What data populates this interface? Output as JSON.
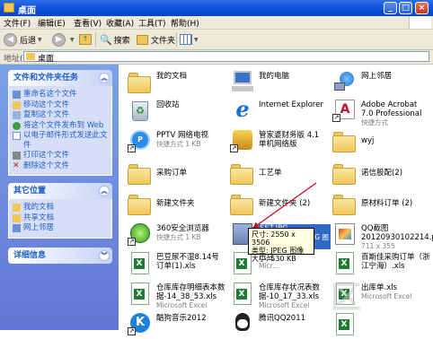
{
  "window": {
    "title": "桌面",
    "buttons": {
      "minimize": "_",
      "maximize": "□",
      "close": "×"
    }
  },
  "menu": [
    "文件(F)",
    "编辑(E)",
    "查看(V)",
    "收藏(A)",
    "工具(T)",
    "帮助(H)"
  ],
  "toolbar": {
    "back": "后退",
    "search": "搜索",
    "folders": "文件夹"
  },
  "address": {
    "label": "地址(D)",
    "value": "桌面"
  },
  "left_panels": [
    {
      "title": "文件和文件夹任务",
      "tasks": [
        "重命名这个文件",
        "移动这个文件",
        "复制这个文件",
        "将这个文件发布到 Web",
        "以电子邮件形式发送此文件",
        "打印这个文件",
        "删除这个文件"
      ]
    },
    {
      "title": "其它位置",
      "tasks": [
        "我的文档",
        "共享文档",
        "网上邻居"
      ]
    },
    {
      "title": "详细信息",
      "tasks": []
    }
  ],
  "icon_colors": {
    "folder": "#efc75a",
    "excel": "#1e7b34",
    "ie": "#1c6fd8",
    "adobe": "#c8102e"
  },
  "items": [
    {
      "name": "我的文档",
      "sub": "",
      "icon": "my-documents-icon"
    },
    {
      "name": "我的电脑",
      "sub": "",
      "icon": "my-computer-icon"
    },
    {
      "name": "网上邻居",
      "sub": "",
      "icon": "network-places-icon"
    },
    {
      "name": "回收站",
      "sub": "",
      "icon": "recycle-bin-icon"
    },
    {
      "name": "Internet Explorer",
      "sub": "",
      "icon": "internet-explorer-icon"
    },
    {
      "name": "Adobe Acrobat 7.0 Professional",
      "sub": "快捷方式",
      "icon": "adobe-acrobat-icon"
    },
    {
      "name": "PPTV 网络电视",
      "sub": "快捷方式 1 KB",
      "icon": "pptv-icon"
    },
    {
      "name": "管家婆财务版 4.1 单机网络版",
      "sub": "",
      "icon": "finance-app-icon"
    },
    {
      "name": "wyj",
      "sub": "",
      "icon": "folder-icon"
    },
    {
      "name": "采购订单",
      "sub": "",
      "icon": "folder-icon"
    },
    {
      "name": "工艺单",
      "sub": "",
      "icon": "folder-icon"
    },
    {
      "name": "诺信股配(2)",
      "sub": "",
      "icon": "folder-icon"
    },
    {
      "name": "新建文件夹",
      "sub": "",
      "icon": "folder-icon"
    },
    {
      "name": "新建文件夹 (2)",
      "sub": "",
      "icon": "folder-icon"
    },
    {
      "name": "原材料订单 (2)",
      "sub": "",
      "icon": "folder-icon"
    },
    {
      "name": "360安全浏览器",
      "sub": "快捷方式 1 KB",
      "icon": "browser-360-icon"
    },
    {
      "name": "SST.JPG",
      "sub": "2550 x 3506 JPEG 图像",
      "icon": "jpeg-image-icon"
    },
    {
      "name": "QQ截图 20120930102214.png",
      "sub": "711 x 355",
      "icon": "png-image-icon"
    },
    {
      "name": "巴豆尿不湿8.14号订单(1).xls",
      "sub": "",
      "icon": "excel-file-icon"
    },
    {
      "name": "巴豆",
      "sub": "Micr...",
      "icon": "excel-file-icon"
    },
    {
      "name": "百斯佳采购订单（浙江宁海）.xls",
      "sub": "",
      "icon": "excel-file-icon"
    },
    {
      "name": "仓库库存明细表本数据-14_38_53.xls",
      "sub": "Microsoft Excel",
      "icon": "excel-file-icon"
    },
    {
      "name": "仓库库存状况表数据-10_17_33.xls",
      "sub": "Microsoft Excel",
      "icon": "excel-file-icon"
    },
    {
      "name": "出库单.xls",
      "sub": "Microsoft Excel",
      "icon": "excel-file-icon"
    },
    {
      "name": "酷狗音乐2012",
      "sub": "",
      "icon": "kugou-icon"
    },
    {
      "name": "腾讯QQ2011",
      "sub": "",
      "icon": "qq-icon"
    },
    {
      "name": "",
      "sub": "",
      "icon": "excel-file-icon"
    }
  ],
  "tooltip": {
    "line1": "尺寸: 2550 x 3506",
    "line2": "类型: JPEG 图像",
    "line3": "大小: 530 KB"
  },
  "watermark": "区"
}
